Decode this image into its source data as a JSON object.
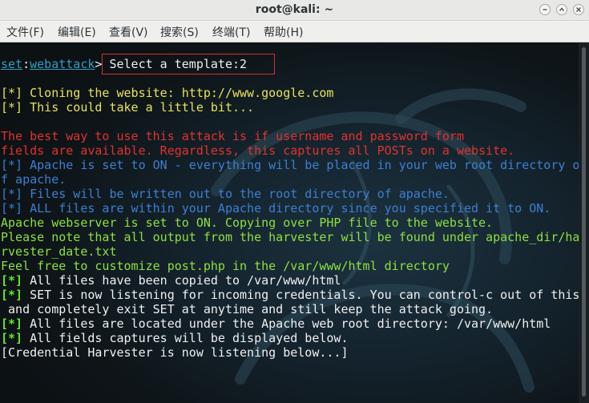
{
  "window": {
    "title": "root@kali: ~"
  },
  "menu": {
    "items": [
      "文件(F)",
      "编辑(E)",
      "查看(V)",
      "搜索(S)",
      "终端(T)",
      "帮助(H)"
    ]
  },
  "terminal": {
    "prompt": {
      "word1": "set",
      "sep": ":",
      "word2": "webattack",
      "arrow": ">",
      "text": " Select a template:2"
    },
    "lines": [
      {
        "text": "[*] Cloning the website: http://www.google.com",
        "color": "yellow"
      },
      {
        "text": "[*] This could take a little bit...",
        "color": "yellow"
      },
      {
        "text": "The best way to use this attack is if username and password form",
        "color": "red"
      },
      {
        "text": "fields are available. Regardless, this captures all POSTs on a website.",
        "color": "red"
      },
      {
        "text": "[*] Apache is set to ON - everything will be placed in your web root directory o",
        "color": "blue"
      },
      {
        "text": "f apache.",
        "color": "blue"
      },
      {
        "text": "[*] Files will be written out to the root directory of apache.",
        "color": "blue"
      },
      {
        "text": "[*] ALL files are within your Apache directory since you specified it to ON.",
        "color": "blue"
      },
      {
        "text": "Apache webserver is set to ON. Copying over PHP file to the website.",
        "color": "green"
      },
      {
        "text": "Please note that all output from the harvester will be found under apache_dir/ha",
        "color": "green"
      },
      {
        "text": "rvester_date.txt",
        "color": "green"
      },
      {
        "text": "Feel free to customize post.php in the /var/www/html directory",
        "color": "green"
      }
    ],
    "status_lines": [
      {
        "tag": "[*]",
        "text": " All files have been copied to /var/www/html"
      },
      {
        "tag": "[*]",
        "text": " SET is now listening for incoming credentials. You can control-c out of this"
      },
      {
        "tag": "",
        "text": " and completely exit SET at anytime and still keep the attack going."
      },
      {
        "tag": "[*]",
        "text": " All files are located under the Apache web root directory: /var/www/html"
      },
      {
        "tag": "[*]",
        "text": " All fields captures will be displayed below."
      }
    ],
    "final_line": "[Credential Harvester is now listening below...]"
  },
  "colors": {
    "yellow": "#e7e35a",
    "red": "#e0332f",
    "blue": "#3e7fd0",
    "green": "#8ee040",
    "bright_green": "#63e82a"
  }
}
